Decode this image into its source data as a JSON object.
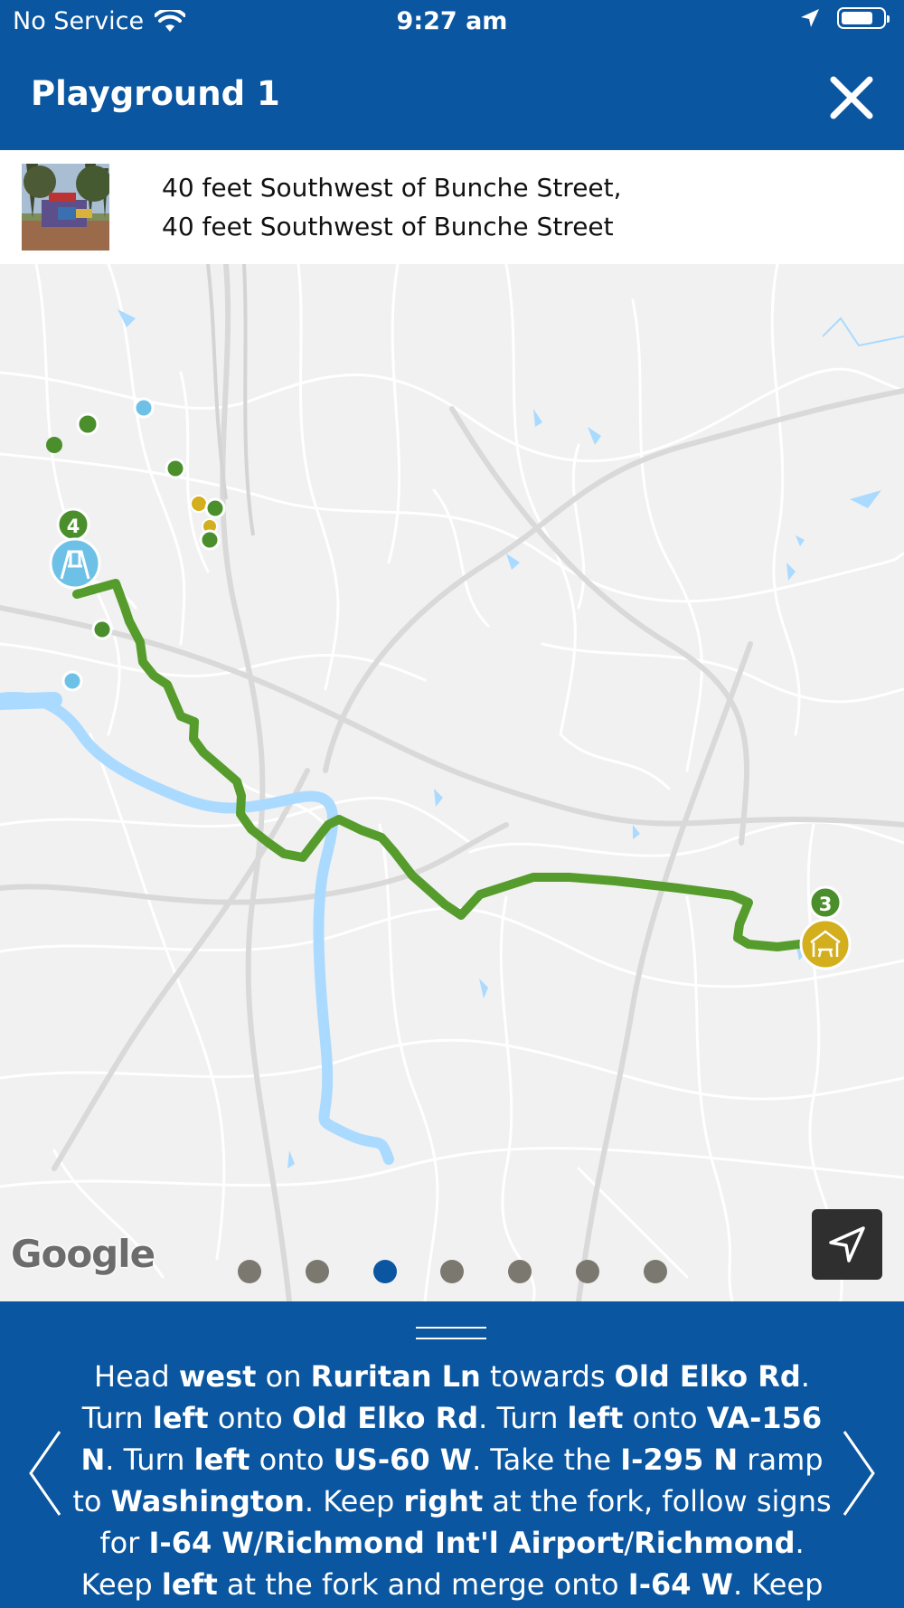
{
  "status_bar": {
    "carrier": "No Service",
    "time": "9:27 am"
  },
  "header": {
    "title": "Playground 1",
    "close_icon": "close-icon"
  },
  "location": {
    "line1": "40 feet Southwest of Bunche Street,",
    "line2": "40 feet Southwest of Bunche Street"
  },
  "map": {
    "attribution": "Google",
    "route_color": "#569c2c",
    "markers": [
      {
        "label": "4",
        "icon": "swing-icon",
        "color": "#6ec1e6"
      },
      {
        "label": "3",
        "icon": "picnic-shelter-icon",
        "color": "#d3ae1d"
      }
    ],
    "page_count": 7,
    "active_page": 3
  },
  "directions": {
    "segments": [
      {
        "t": "Head ",
        "b": false
      },
      {
        "t": "west",
        "b": true
      },
      {
        "t": " on ",
        "b": false
      },
      {
        "t": "Ruritan Ln",
        "b": true
      },
      {
        "t": " towards ",
        "b": false
      },
      {
        "t": "Old Elko Rd",
        "b": true
      },
      {
        "t": ". Turn ",
        "b": false
      },
      {
        "t": "left",
        "b": true
      },
      {
        "t": " onto ",
        "b": false
      },
      {
        "t": "Old Elko Rd",
        "b": true
      },
      {
        "t": ". Turn ",
        "b": false
      },
      {
        "t": "left",
        "b": true
      },
      {
        "t": " onto ",
        "b": false
      },
      {
        "t": "VA-156 N",
        "b": true
      },
      {
        "t": ". Turn ",
        "b": false
      },
      {
        "t": "left",
        "b": true
      },
      {
        "t": " onto ",
        "b": false
      },
      {
        "t": "US-60 W",
        "b": true
      },
      {
        "t": ". Take the ",
        "b": false
      },
      {
        "t": "I-295 N",
        "b": true
      },
      {
        "t": " ramp to ",
        "b": false
      },
      {
        "t": "Washington",
        "b": true
      },
      {
        "t": ". Keep ",
        "b": false
      },
      {
        "t": "right",
        "b": true
      },
      {
        "t": " at the fork, follow signs for ",
        "b": false
      },
      {
        "t": "I-64 W",
        "b": true
      },
      {
        "t": "/",
        "b": false
      },
      {
        "t": "Richmond Int'l Airport",
        "b": true
      },
      {
        "t": "/",
        "b": false
      },
      {
        "t": "Richmond",
        "b": true
      },
      {
        "t": ". Keep ",
        "b": false
      },
      {
        "t": "left",
        "b": true
      },
      {
        "t": " at the fork and merge onto ",
        "b": false
      },
      {
        "t": "I-64 W",
        "b": true
      },
      {
        "t": ". Keep",
        "b": false
      }
    ]
  }
}
